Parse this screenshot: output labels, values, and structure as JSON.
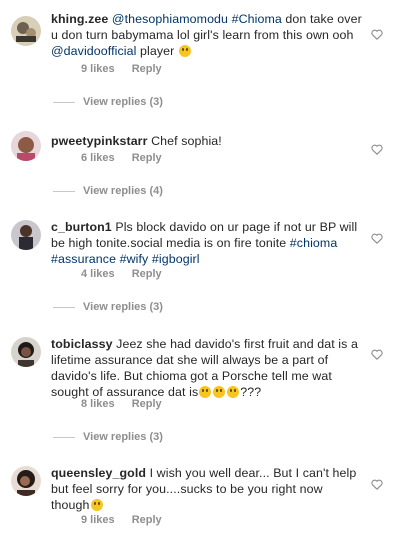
{
  "comments": [
    {
      "username": "khing.zee",
      "text_parts": [
        {
          "t": " "
        },
        {
          "t": "@thesophiamomodu",
          "tag": true
        },
        {
          "t": " "
        },
        {
          "t": "#Chioma",
          "tag": true
        },
        {
          "t": " don take over u don turn babymama lol  girl's learn from this own ooh "
        },
        {
          "t": "@davidoofficial",
          "tag": true
        },
        {
          "t": " player "
        },
        {
          "emoji": "grinning-sweat"
        }
      ],
      "likes": "9 likes",
      "reply": "Reply",
      "view_replies": "View replies (3)"
    },
    {
      "username": "pweetypinkstarr",
      "text_parts": [
        {
          "t": " Chef sophia!"
        }
      ],
      "likes": "6 likes",
      "reply": "Reply",
      "view_replies": "View replies (4)"
    },
    {
      "username": "c_burton1",
      "text_parts": [
        {
          "t": " Pls block davido on ur page if not ur BP will be high tonite.social media is on fire tonite "
        },
        {
          "t": "#chioma",
          "tag": true
        },
        {
          "t": " "
        },
        {
          "t": "#assurance",
          "tag": true
        },
        {
          "t": " "
        },
        {
          "t": "#wify",
          "tag": true
        },
        {
          "t": " "
        },
        {
          "t": "#igbogirl",
          "tag": true
        }
      ],
      "likes": "4 likes",
      "reply": "Reply",
      "view_replies": "View replies (3)"
    },
    {
      "username": "tobiclassy",
      "text_parts": [
        {
          "t": " Jeez she had davido's first fruit and dat  is a lifetime assurance dat  she will always be a part of davido's life. But chioma got a Porsche tell me wat sought of assurance dat  is"
        },
        {
          "emoji": "joy"
        },
        {
          "emoji": "joy"
        },
        {
          "emoji": "joy"
        },
        {
          "t": "???"
        }
      ],
      "likes": "8 likes",
      "reply": "Reply",
      "view_replies": "View replies (3)"
    },
    {
      "username": "queensley_gold",
      "text_parts": [
        {
          "t": " I wish you well dear... But I can't help but feel sorry for you....sucks to be you right now though"
        },
        {
          "emoji": "disappointed-relieved"
        }
      ],
      "likes": "9 likes",
      "reply": "Reply",
      "view_replies": ""
    }
  ],
  "icons": {
    "like": "heart-outline-icon"
  },
  "colors": {
    "text": "#262626",
    "muted": "#8e8e8e",
    "tag": "#003569",
    "divider": "#c7c7c7"
  }
}
